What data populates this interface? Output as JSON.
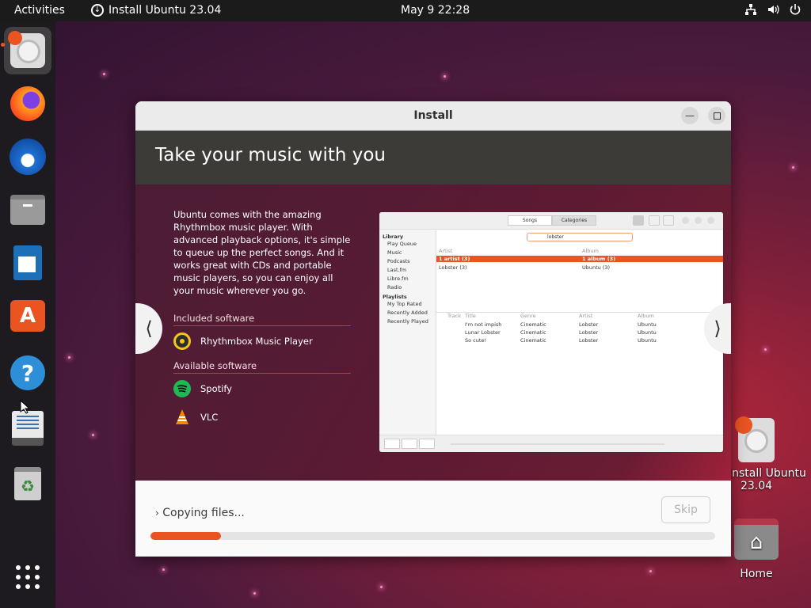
{
  "topbar": {
    "activities": "Activities",
    "app_indicator": "Install Ubuntu 23.04",
    "clock": "May 9  22:28"
  },
  "dock": {
    "apps": [
      "ubuntu-installer-icon",
      "firefox-icon",
      "thunderbird-icon",
      "files-icon",
      "libreoffice-writer-icon",
      "app-center-icon",
      "help-icon",
      "text-editor-icon",
      "trash-icon",
      "show-apps-icon"
    ]
  },
  "desktop": {
    "installer_label_line1": "Install Ubuntu",
    "installer_label_line2": "23.04",
    "home_label": "Home"
  },
  "window": {
    "title": "Install",
    "heading": "Take your music with you",
    "description": "Ubuntu comes with the amazing Rhythmbox music player. With advanced playback options, it's simple to queue up the perfect songs. And it works great with CDs and portable music players, so you can enjoy all your music wherever you go.",
    "included_label": "Included software",
    "included": [
      "Rhythmbox Music Player"
    ],
    "available_label": "Available software",
    "available": [
      "Spotify",
      "VLC"
    ],
    "status": "Copying files...",
    "skip_label": "Skip",
    "progress_fraction": 0.125
  },
  "rhythmbox": {
    "tabs": [
      "Songs",
      "Categories"
    ],
    "search_value": "lobster",
    "library_header": "Library",
    "library_items": [
      "Play Queue",
      "Music",
      "Podcasts",
      "Last.fm",
      "Libre.fm",
      "Radio"
    ],
    "playlists_header": "Playlists",
    "playlist_items": [
      "My Top Rated",
      "Recently Added",
      "Recently Played"
    ],
    "browser_headers": [
      "Artist",
      "Album"
    ],
    "browser_rows": [
      [
        "1 artist (3)",
        "1 album (3)"
      ],
      [
        "Lobster (3)",
        "Ubuntu (3)"
      ]
    ],
    "track_headers": [
      "Track",
      "Title",
      "Genre",
      "Artist",
      "Album"
    ],
    "tracks": [
      [
        "I'm not impish",
        "Cinematic",
        "Lobster",
        "Ubuntu"
      ],
      [
        "Lunar Lobster",
        "Cinematic",
        "Lobster",
        "Ubuntu"
      ],
      [
        "So cute!",
        "Cinematic",
        "Lobster",
        "Ubuntu"
      ]
    ]
  },
  "colors": {
    "accent": "#e95420",
    "topbar": "#1b1b1b",
    "dock": "#1e1b20",
    "heading_bar": "#3c3b37"
  }
}
